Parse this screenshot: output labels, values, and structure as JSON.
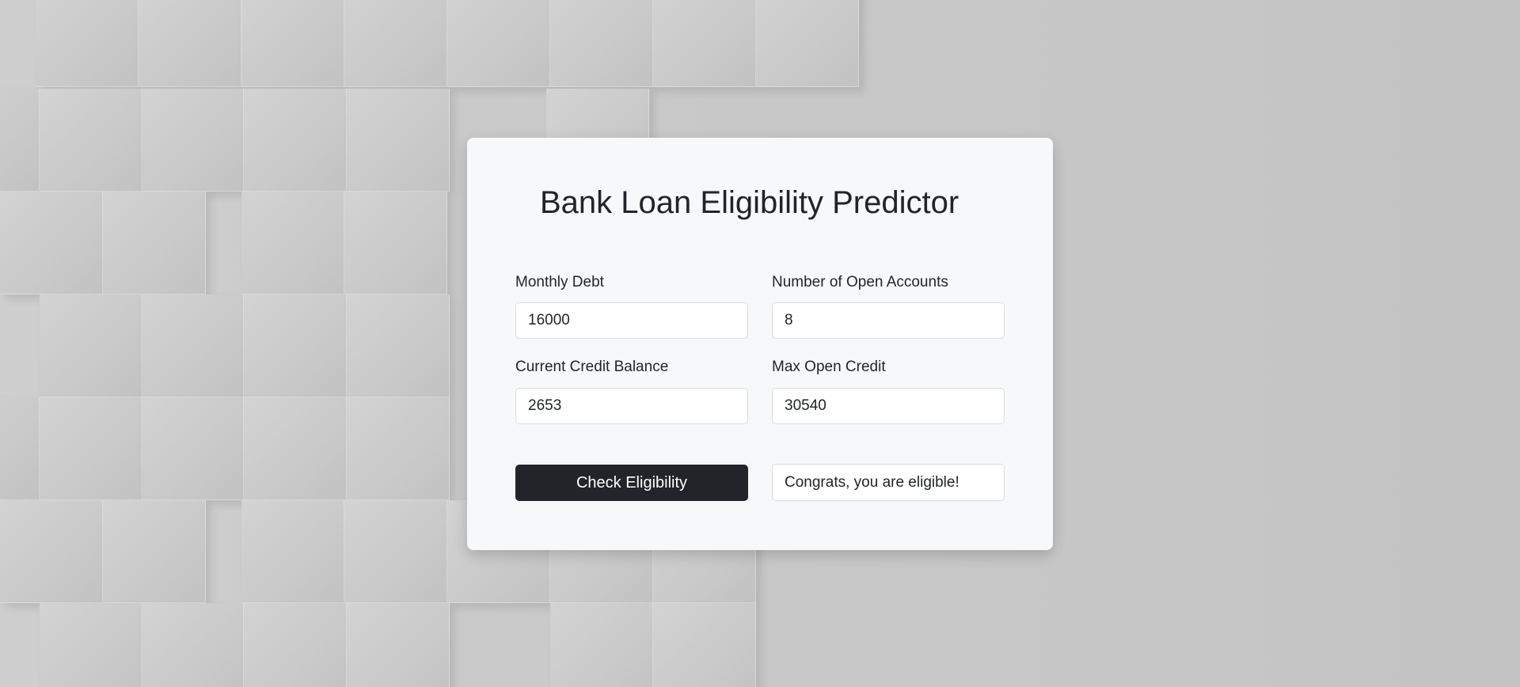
{
  "page": {
    "title": "Bank Loan Eligibility Predictor"
  },
  "form": {
    "monthly_debt": {
      "label": "Monthly Debt",
      "value": "16000"
    },
    "open_accounts": {
      "label": "Number of Open Accounts",
      "value": "8"
    },
    "credit_balance": {
      "label": "Current Credit Balance",
      "value": "2653"
    },
    "max_open_credit": {
      "label": "Max Open Credit",
      "value": "30540"
    },
    "submit_label": "Check Eligibility",
    "result_text": "Congrats, you are eligible!"
  }
}
